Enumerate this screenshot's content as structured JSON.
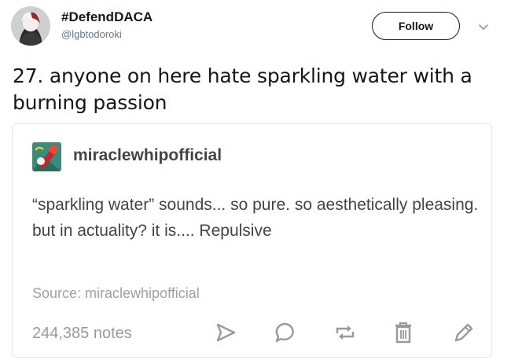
{
  "tweet": {
    "display_name": "#DefendDACA",
    "handle": "@lgbtodoroki",
    "follow_label": "Follow",
    "text": "27. anyone on here hate sparkling water with a burning passion"
  },
  "embedded_post": {
    "blog_name": "miraclewhipofficial",
    "text": "“sparkling water” sounds... so pure. so aesthetically pleasing. but in actuality? it is.... Repulsive",
    "source": "Source: miraclewhipofficial",
    "notes": "244,385 notes",
    "actions": [
      "share-icon",
      "reply-icon",
      "reblog-icon",
      "delete-icon",
      "edit-icon"
    ]
  }
}
